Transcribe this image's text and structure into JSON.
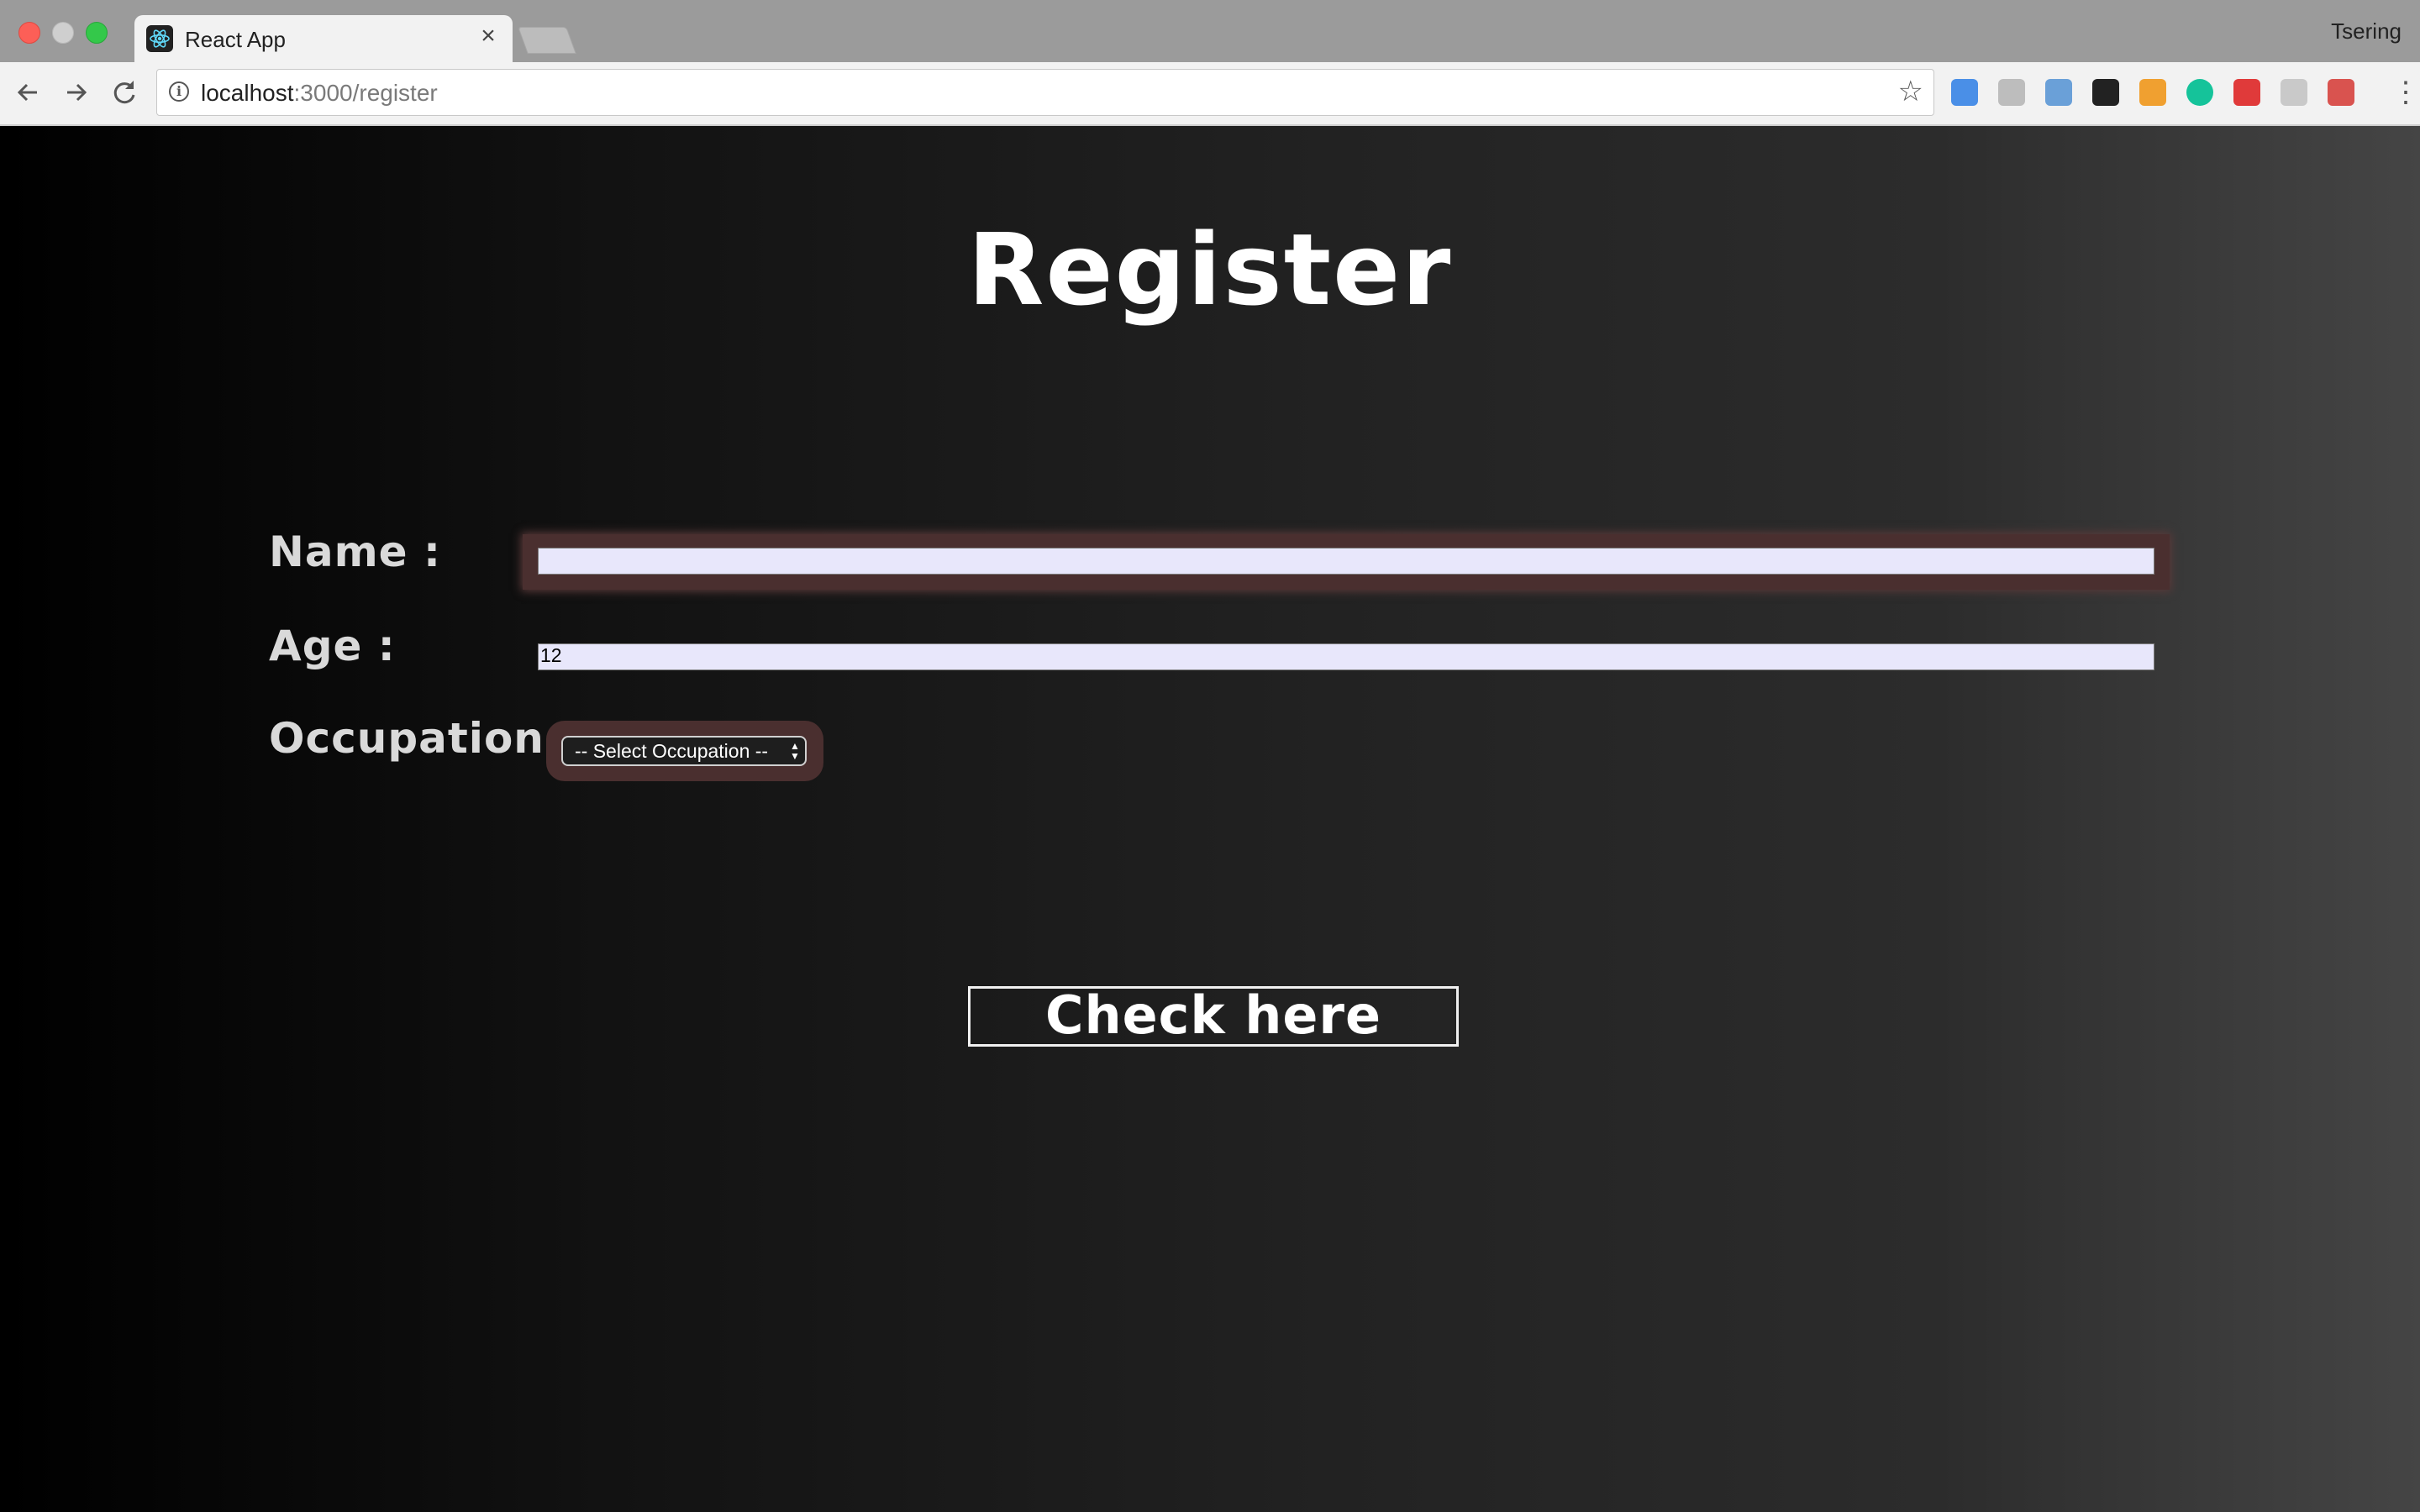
{
  "browser": {
    "tab_title": "React App",
    "tab_close": "×",
    "profile_name": "Tsering",
    "url_host": "localhost",
    "url_path": ":3000/register",
    "extensions": [
      {
        "name": "tag-extension-icon",
        "color": "#4a8fe7"
      },
      {
        "name": "grey-extension-icon",
        "color": "#bdbdbd"
      },
      {
        "name": "chart-extension-icon",
        "color": "#6aa0d8"
      },
      {
        "name": "eyedropper-extension-icon",
        "color": "#222222"
      },
      {
        "name": "trend-extension-icon",
        "color": "#f0a030"
      },
      {
        "name": "grammarly-extension-icon",
        "color": "#15c39a"
      },
      {
        "name": "shield-extension-icon",
        "color": "#e03a3a"
      },
      {
        "name": "braces-extension-icon",
        "color": "#c9c9c9"
      },
      {
        "name": "bug-extension-icon",
        "color": "#d9534f"
      }
    ]
  },
  "page": {
    "title": "Register",
    "form": {
      "name_label": "Name :",
      "name_value": "",
      "age_label": "Age :",
      "age_value": "12",
      "occupation_label": "Occupation:",
      "occupation_selected": "-- Select Occupation --"
    },
    "submit_label": "Check here"
  },
  "colors": {
    "field_bg": "#e8e7fb",
    "field_glow": "#4a2f2f",
    "title": "#ffffff",
    "label": "#d9d9d9"
  }
}
